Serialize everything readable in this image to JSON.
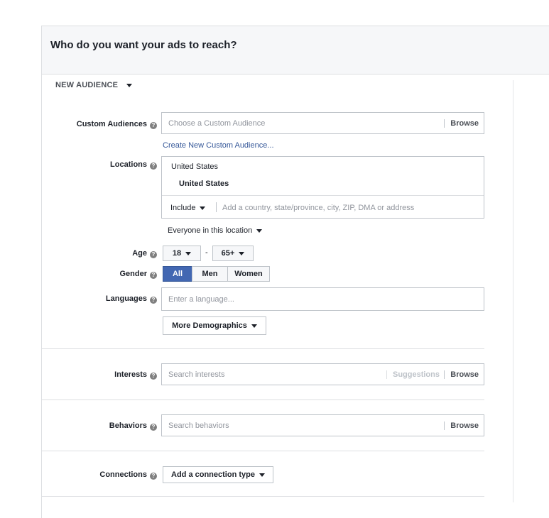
{
  "panel": {
    "title": "Who do you want your ads to reach?"
  },
  "audience": {
    "label": "NEW AUDIENCE"
  },
  "custom_audiences": {
    "label": "Custom Audiences",
    "placeholder": "Choose a Custom Audience",
    "browse": "Browse",
    "create_link": "Create New Custom Audience..."
  },
  "locations": {
    "label": "Locations",
    "country_header": "United States",
    "selected": "United States",
    "include": "Include",
    "placeholder": "Add a country, state/province, city, ZIP, DMA or address",
    "scope": "Everyone in this location"
  },
  "age": {
    "label": "Age",
    "min": "18",
    "dash": "-",
    "max": "65+"
  },
  "gender": {
    "label": "Gender",
    "options": [
      "All",
      "Men",
      "Women"
    ],
    "selected": "All"
  },
  "languages": {
    "label": "Languages",
    "placeholder": "Enter a language..."
  },
  "more_demographics": {
    "label": "More Demographics"
  },
  "interests": {
    "label": "Interests",
    "placeholder": "Search interests",
    "suggestions": "Suggestions",
    "browse": "Browse"
  },
  "behaviors": {
    "label": "Behaviors",
    "placeholder": "Search behaviors",
    "browse": "Browse"
  },
  "connections": {
    "label": "Connections",
    "button": "Add a connection type"
  },
  "colors": {
    "accent": "#4267b2",
    "link": "#365899",
    "border": "#bec3c9"
  },
  "icons": {
    "help": "help-circle-icon",
    "dropdown": "caret-down-icon"
  }
}
